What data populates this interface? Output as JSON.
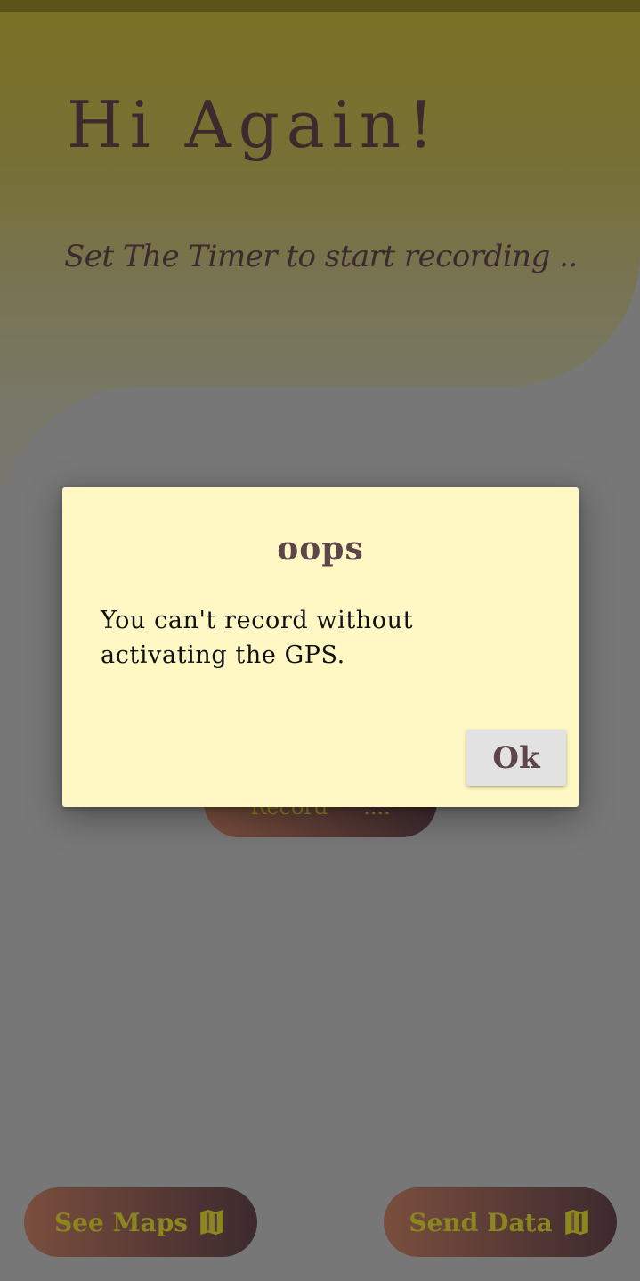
{
  "header": {
    "title": "Hi Again!",
    "subtitle": "Set The Timer to start recording .."
  },
  "record_button": {
    "label": "Record",
    "timer": "...."
  },
  "bottom_nav": {
    "see_maps_label": "See Maps",
    "send_data_label": "Send Data"
  },
  "dialog": {
    "title": "oops",
    "message": "You can't record without activating the GPS.",
    "ok_label": "Ok"
  },
  "colors": {
    "header_top": "#7b7226",
    "background": "#777777",
    "dialog_bg": "#fff8c4",
    "accent_text": "#8c8620",
    "button_gradient_start": "#7a4e3e",
    "button_gradient_end": "#3d2a2e"
  },
  "icons": {
    "map": "map-icon"
  }
}
